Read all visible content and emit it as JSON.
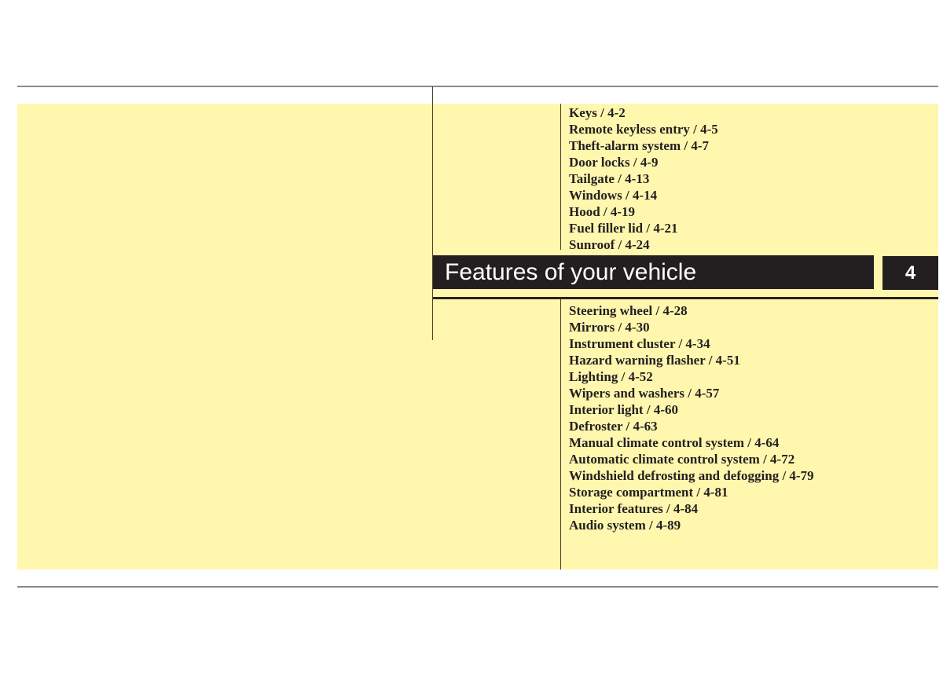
{
  "chapter": {
    "title": "Features of your vehicle",
    "number": "4"
  },
  "colors": {
    "panel": "#fff7ae",
    "title_bar": "#231f20",
    "title_text": "#ffffff",
    "rule": "#8a8a8a"
  },
  "toc_upper": [
    {
      "label": "Keys / 4-2"
    },
    {
      "label": "Remote keyless entry / 4-5"
    },
    {
      "label": "Theft-alarm system / 4-7"
    },
    {
      "label": "Door locks / 4-9"
    },
    {
      "label": "Tailgate / 4-13"
    },
    {
      "label": "Windows / 4-14"
    },
    {
      "label": "Hood / 4-19"
    },
    {
      "label": "Fuel filler lid / 4-21"
    },
    {
      "label": "Sunroof / 4-24"
    }
  ],
  "toc_lower": [
    {
      "label": "Steering wheel / 4-28"
    },
    {
      "label": "Mirrors / 4-30"
    },
    {
      "label": "Instrument cluster / 4-34"
    },
    {
      "label": "Hazard warning flasher / 4-51"
    },
    {
      "label": "Lighting / 4-52"
    },
    {
      "label": "Wipers and washers / 4-57"
    },
    {
      "label": "Interior light / 4-60"
    },
    {
      "label": "Defroster / 4-63"
    },
    {
      "label": "Manual climate control system / 4-64"
    },
    {
      "label": "Automatic climate control system / 4-72"
    },
    {
      "label": "Windshield defrosting and defogging / 4-79"
    },
    {
      "label": "Storage compartment / 4-81"
    },
    {
      "label": "Interior features / 4-84"
    },
    {
      "label": "Audio system / 4-89"
    }
  ]
}
